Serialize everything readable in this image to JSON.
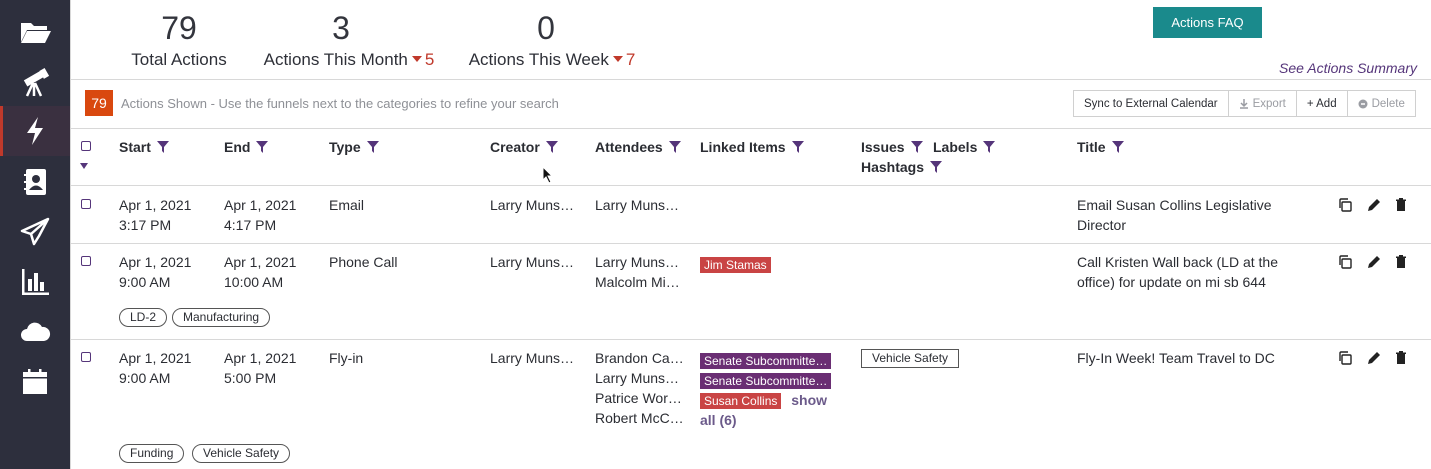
{
  "sidebar": {
    "items": [
      {
        "icon": "folder-open-icon"
      },
      {
        "icon": "telescope-icon"
      },
      {
        "icon": "lightning-icon",
        "active": true
      },
      {
        "icon": "contact-book-icon"
      },
      {
        "icon": "paper-plane-icon"
      },
      {
        "icon": "bar-chart-icon"
      },
      {
        "icon": "cloud-icon"
      },
      {
        "icon": "calendar-icon"
      }
    ]
  },
  "stats": {
    "total": {
      "value": "79",
      "label": "Total Actions"
    },
    "month": {
      "value": "3",
      "label": "Actions This Month",
      "delta": "5"
    },
    "week": {
      "value": "0",
      "label": "Actions This Week",
      "delta": "7"
    }
  },
  "faq_button": "Actions FAQ",
  "see_summary": "See Actions Summary",
  "toolbar": {
    "count": "79",
    "shown_text": "Actions Shown - Use the funnels next to the categories to refine your search",
    "sync_label": "Sync to External Calendar",
    "export_label": "Export",
    "add_label": "+ Add",
    "delete_label": "Delete"
  },
  "columns": {
    "start": "Start",
    "end": "End",
    "type": "Type",
    "creator": "Creator",
    "attendees": "Attendees",
    "linked_items": "Linked Items",
    "issues": "Issues",
    "labels": "Labels",
    "hashtags": "Hashtags",
    "title": "Title"
  },
  "rows": [
    {
      "start_date": "Apr 1, 2021",
      "start_time": "3:17 PM",
      "end_date": "Apr 1, 2021",
      "end_time": "4:17 PM",
      "type": "Email",
      "creator": "Larry Muns…",
      "attendees": [
        "Larry Muns…"
      ],
      "title": "Email Susan Collins Legislative Director"
    },
    {
      "start_date": "Apr 1, 2021",
      "start_time": "9:00 AM",
      "end_date": "Apr 1, 2021",
      "end_time": "10:00 AM",
      "type": "Phone Call",
      "creator": "Larry Muns…",
      "attendees": [
        "Larry Muns…",
        "Malcolm Mi…"
      ],
      "linked": [
        "Jim Stamas"
      ],
      "labels": [
        "LD-2",
        "Manufacturing"
      ],
      "title": "Call Kristen Wall back (LD at the office) for update on mi sb 644"
    },
    {
      "start_date": "Apr 1, 2021",
      "start_time": "9:00 AM",
      "end_date": "Apr 1, 2021",
      "end_time": "5:00 PM",
      "type": "Fly-in",
      "creator": "Larry Muns…",
      "attendees": [
        "Brandon Ca…",
        "Larry Muns…",
        "Patrice Wor…",
        "Robert McC…"
      ],
      "linked": [
        "Senate Subcommitte…",
        "Senate Subcommitte…",
        "Susan Collins"
      ],
      "show_all_1": "show",
      "show_all_2": "all (6)",
      "issue": "Vehicle Safety",
      "labels": [
        "Funding",
        "Vehicle Safety"
      ],
      "title": "Fly-In Week! Team Travel to DC"
    }
  ]
}
